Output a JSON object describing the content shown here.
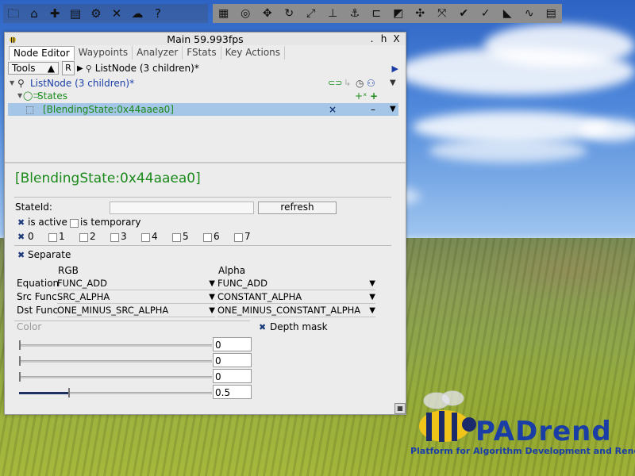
{
  "toolbar_left": [
    "folder-icon",
    "house-icon",
    "puzzle-icon",
    "list-icon",
    "gear-icon",
    "tools-icon",
    "weather-icon",
    "help-icon"
  ],
  "toolbar_left_glyphs": [
    "🗀",
    "⌂",
    "✚",
    "▤",
    "⚙",
    "✕",
    "☁",
    "?"
  ],
  "toolbar_right": [
    "table-icon",
    "camera-icon",
    "move-icon",
    "rotate-icon",
    "scale-icon",
    "height-icon",
    "anchor-icon",
    "measure-icon",
    "terrain-icon",
    "transform-icon",
    "translate-icon",
    "check-icon",
    "check-icon",
    "flag-icon",
    "path-icon",
    "notes-icon"
  ],
  "toolbar_right_glyphs": [
    "▦",
    "◎",
    "✥",
    "↻",
    "⤢",
    "⊥",
    "⚓",
    "⊏",
    "◩",
    "✣",
    "⤧",
    "✔",
    "✓",
    "◣",
    "∿",
    "▤"
  ],
  "window": {
    "title": "Main 59.993fps",
    "btn_dot": ".",
    "btn_h": "h",
    "btn_x": "X",
    "tabs": [
      "Node Editor",
      "Waypoints",
      "Analyzer",
      "FStats",
      "Key Actions"
    ]
  },
  "pathbar": {
    "tools": "Tools",
    "tools_arrow": "▲",
    "r": "R",
    "play": "▶",
    "path": "ListNode (3 children)*",
    "end_arrow": "▶"
  },
  "tree": {
    "root": "ListNode (3 children)*",
    "states": "States",
    "blending": "[BlendingState:0x44aaea0]",
    "x_mark": "×",
    "minus": "–",
    "plus": "+",
    "plus_x": "+ˣ",
    "down": "▼"
  },
  "props": {
    "heading": "[BlendingState:0x44aaea0]",
    "stateid_label": "StateId:",
    "refresh": "refresh",
    "is_active": "is active",
    "is_temporary": "is temporary",
    "slots": [
      "0",
      "1",
      "2",
      "3",
      "4",
      "5",
      "6",
      "7"
    ],
    "separate": "Separate",
    "col_rgb": "RGB",
    "col_alpha": "Alpha",
    "equation_label": "Equation",
    "src_label": "Src Func",
    "dst_label": "Dst Func",
    "equation_rgb": "FUNC_ADD",
    "equation_alpha": "FUNC_ADD",
    "src_rgb": "SRC_ALPHA",
    "src_alpha": "CONSTANT_ALPHA",
    "dst_rgb": "ONE_MINUS_SRC_ALPHA",
    "dst_alpha": "ONE_MINUS_CONSTANT_ALPHA",
    "arrow": "▼",
    "color_label": "Color",
    "depth_mask": "Depth mask",
    "color_values": [
      "0",
      "0",
      "0",
      "0.5"
    ],
    "color_levels": [
      0,
      0,
      0,
      0.5
    ],
    "check": "✖"
  },
  "logo": {
    "title": "PADrend",
    "subtitle": "Platform for Algorithm Development and Rendering"
  }
}
